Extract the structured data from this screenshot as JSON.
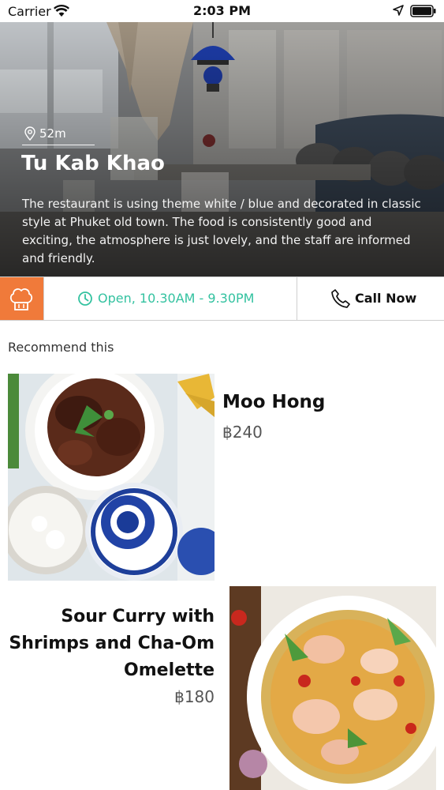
{
  "status_bar": {
    "carrier": "Carrier",
    "time": "2:03 PM"
  },
  "restaurant": {
    "distance": "52m",
    "name": "Tu Kab Khao",
    "description": "The restaurant is using theme white / blue and decorated in classic style at Phuket old town. The food is consistently good and exciting, the atmosphere is just lovely, and the staff are informed and friendly."
  },
  "actions": {
    "hours": "Open, 10.30AM - 9.30PM",
    "call_label": "Call Now"
  },
  "recommend": {
    "title": "Recommend this",
    "dishes": [
      {
        "name": "Moo Hong",
        "price": "฿240"
      },
      {
        "name": "Sour Curry with Shrimps and Cha-Om Omelette",
        "price": "฿180"
      }
    ]
  },
  "colors": {
    "accent_orange": "#f07a3a",
    "open_green": "#33c2a0"
  },
  "icons": [
    "wifi-icon",
    "location-arrow-icon",
    "battery-icon",
    "map-pin-icon",
    "chef-hat-icon",
    "clock-icon",
    "phone-icon"
  ]
}
